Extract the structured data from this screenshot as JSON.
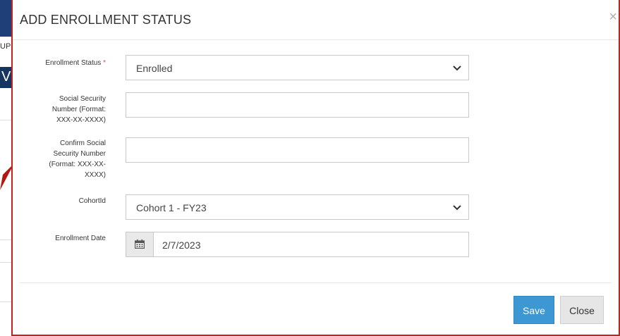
{
  "background": {
    "fragment_text": "UPS",
    "fragment_text2": "VR"
  },
  "modal": {
    "title": "ADD ENROLLMENT STATUS",
    "close_glyph": "×",
    "fields": {
      "enrollment_status": {
        "label": "Enrollment Status",
        "required_mark": "*",
        "value": "Enrolled"
      },
      "ssn": {
        "label_line1": "Social Security",
        "label_line2": "Number (Format:",
        "label_line3": "XXX-XX-XXXX)",
        "value": ""
      },
      "confirm_ssn": {
        "label_line1": "Confirm Social",
        "label_line2": "Security Number",
        "label_line3": "(Format: XXX-XX-",
        "label_line4": "XXXX)",
        "value": ""
      },
      "cohort": {
        "label": "CohortId",
        "value": "Cohort 1 - FY23"
      },
      "enrollment_date": {
        "label": "Enrollment Date",
        "value": "2/7/2023",
        "icon": "calendar-icon"
      }
    },
    "buttons": {
      "save": "Save",
      "close": "Close"
    }
  },
  "colors": {
    "modal_border": "#cc1f1a",
    "primary": "#3c97d2",
    "required": "#d9534f"
  }
}
